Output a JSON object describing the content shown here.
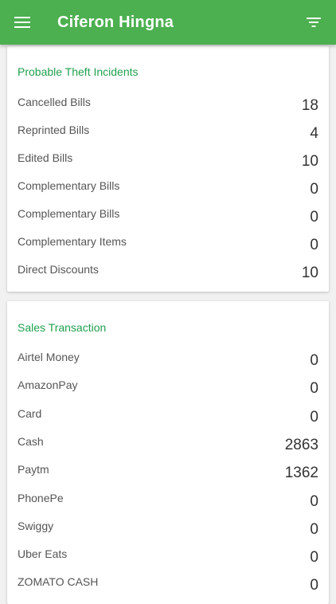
{
  "header": {
    "title": "Ciferon Hingna",
    "menu_icon": "menu-icon",
    "filter_icon": "filter-icon",
    "color": "#4caf50"
  },
  "theft": {
    "title": "Probable Theft Incidents",
    "rows": [
      {
        "label": "Cancelled Bills",
        "value": "18"
      },
      {
        "label": "Reprinted Bills",
        "value": "4"
      },
      {
        "label": "Edited Bills",
        "value": "10"
      },
      {
        "label": "Complementary Bills",
        "value": "0"
      },
      {
        "label": "Complementary Bills",
        "value": "0"
      },
      {
        "label": "Complementary Items",
        "value": "0"
      },
      {
        "label": "Direct Discounts",
        "value": "10"
      }
    ]
  },
  "sales": {
    "title": "Sales Transaction",
    "rows": [
      {
        "label": "Airtel Money",
        "value": "0"
      },
      {
        "label": "AmazonPay",
        "value": "0"
      },
      {
        "label": "Card",
        "value": "0"
      },
      {
        "label": "Cash",
        "value": "2863"
      },
      {
        "label": "Paytm",
        "value": "1362"
      },
      {
        "label": "PhonePe",
        "value": "0"
      },
      {
        "label": "Swiggy",
        "value": "0"
      },
      {
        "label": "Uber Eats",
        "value": "0"
      },
      {
        "label": "ZOMATO CASH",
        "value": "0"
      }
    ]
  }
}
